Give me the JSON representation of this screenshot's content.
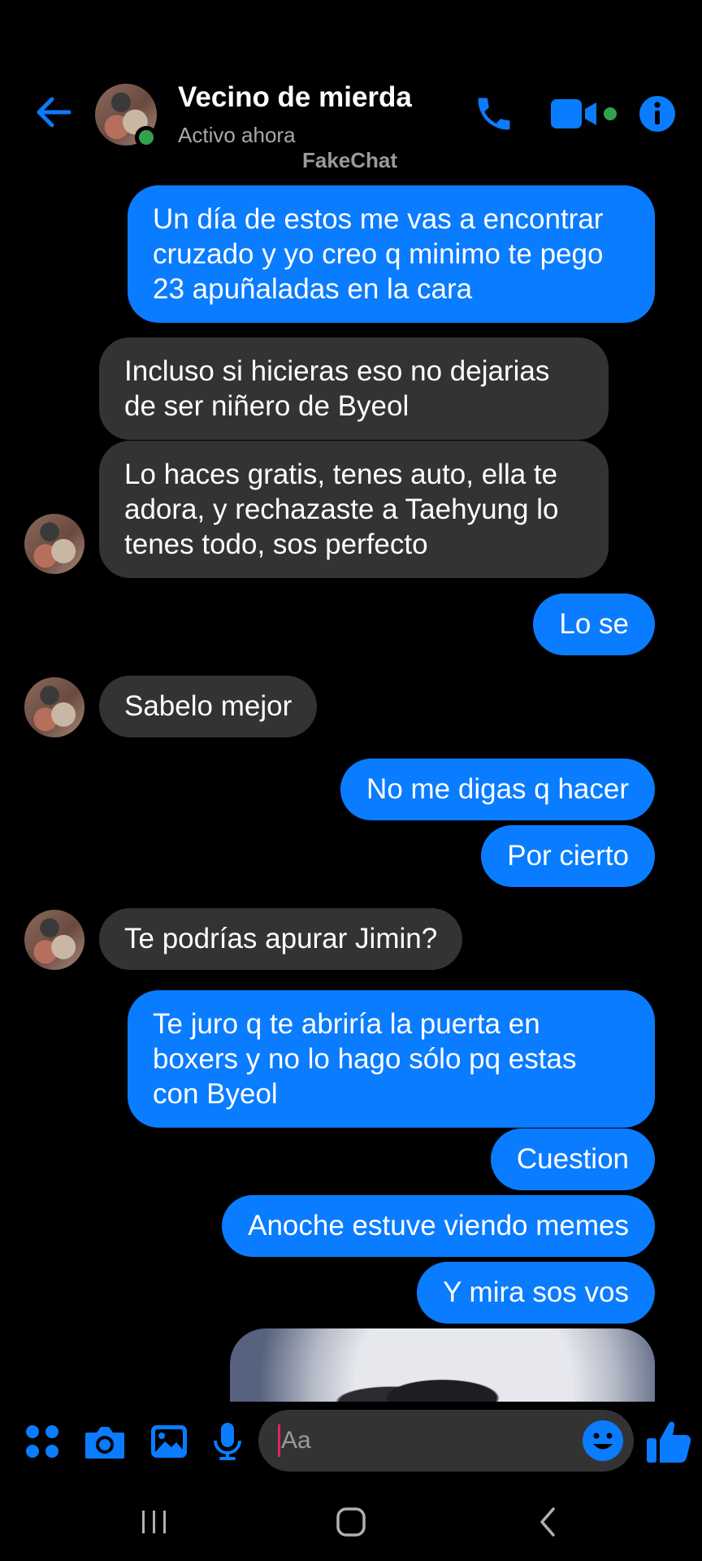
{
  "header": {
    "contact_name": "Vecino de mierda",
    "status": "Activo ahora",
    "watermark": "FakeChat",
    "icons": {
      "back": "back-arrow-icon",
      "call": "phone-icon",
      "video": "video-camera-icon",
      "info": "info-icon"
    }
  },
  "colors": {
    "accent": "#0a7cff",
    "sent_bubble": "#0a7cff",
    "received_bubble": "#333334",
    "online": "#31a24c",
    "background": "#000000"
  },
  "messages": [
    {
      "side": "sent",
      "text": "Un día de estos me vas a encontrar\ncruzado y yo creo q minimo te pego\n23 apuñaladas en la cara"
    },
    {
      "side": "received",
      "text": "Incluso si hicieras eso no dejarias\nde ser niñero de Byeol"
    },
    {
      "side": "received",
      "text": "Lo haces gratis, tenes auto, ella te\nadora, y rechazaste a Taehyung lo\ntenes todo, sos perfecto"
    },
    {
      "side": "sent",
      "text": "Lo se"
    },
    {
      "side": "received",
      "text": "Sabelo mejor"
    },
    {
      "side": "sent",
      "text": "No me digas q hacer"
    },
    {
      "side": "sent",
      "text": "Por cierto"
    },
    {
      "side": "received",
      "text": "Te podrías apurar Jimin?"
    },
    {
      "side": "sent",
      "text": "Te juro q te abriría la puerta en\nboxers y no lo hago sólo pq estas\ncon Byeol"
    },
    {
      "side": "sent",
      "text": "Cuestion"
    },
    {
      "side": "sent",
      "text": "Anoche estuve viendo memes"
    },
    {
      "side": "sent",
      "text": "Y mira sos vos"
    }
  ],
  "composer": {
    "placeholder": "Aa",
    "icons": {
      "apps": "apps-grid-icon",
      "camera": "camera-icon",
      "gallery": "image-icon",
      "mic": "microphone-icon",
      "emoji": "emoji-icon",
      "like": "thumbs-up-icon"
    }
  },
  "navbar": {
    "icons": {
      "recents": "recents-icon",
      "home": "home-icon",
      "back": "back-icon"
    }
  }
}
